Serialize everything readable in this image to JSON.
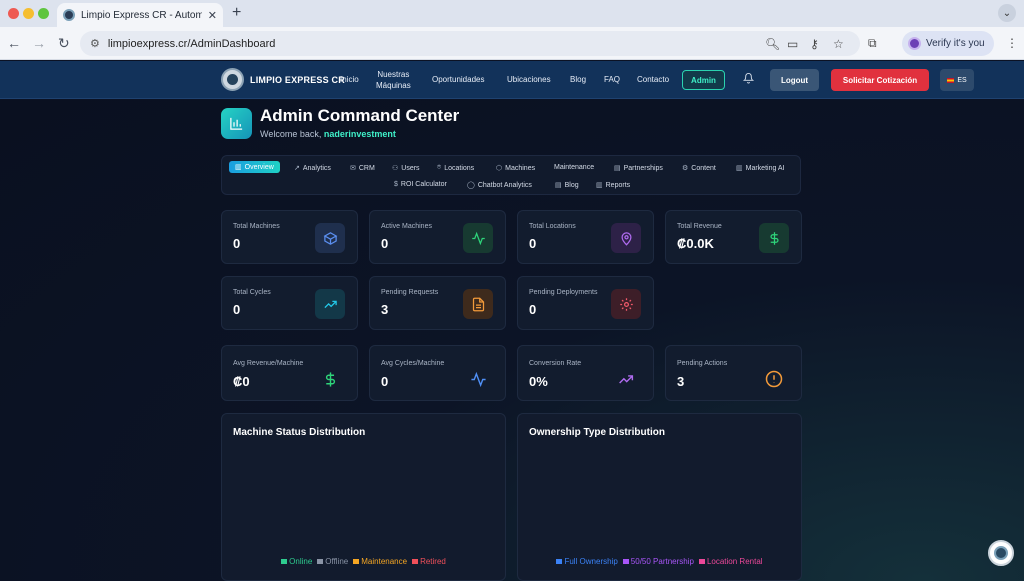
{
  "browser": {
    "tab_title": "Limpio Express CR - Automat",
    "tab_close": "✕",
    "new_tab": "+",
    "menu": "⌄",
    "url": "limpioexpress.cr/AdminDashboard",
    "profile_label": "Verify it's you",
    "back": "←",
    "forward": "→",
    "reload": "↻"
  },
  "header": {
    "brand": "LIMPIO EXPRESS CR",
    "nav": {
      "inicio": "Inicio",
      "maquinas_line1": "Nuestras",
      "maquinas_line2": "Máquinas",
      "oportunidades": "Oportunidades",
      "ubicaciones": "Ubicaciones",
      "blog": "Blog",
      "faq": "FAQ",
      "contacto": "Contacto"
    },
    "admin": "Admin",
    "logout": "Logout",
    "quote": "Solicitar Cotización",
    "lang": "ES"
  },
  "dashboard": {
    "title": "Admin Command Center",
    "welcome_prefix": "Welcome back, ",
    "username": "naderinvestment"
  },
  "tabs": {
    "overview": "Overview",
    "analytics": "Analytics",
    "crm": "CRM",
    "users": "Users",
    "locations": "Locations",
    "machines": "Machines",
    "maintenance": "Maintenance",
    "partnerships": "Partnerships",
    "content": "Content",
    "marketing_ai": "Marketing AI",
    "roi_calculator": "ROI Calculator",
    "chatbot_analytics": "Chatbot Analytics",
    "blog": "Blog",
    "reports": "Reports"
  },
  "stats": {
    "total_machines": {
      "label": "Total Machines",
      "value": "0",
      "color": "#5b8ff0"
    },
    "active_machines": {
      "label": "Active Machines",
      "value": "0",
      "color": "#2ed47a"
    },
    "total_locations": {
      "label": "Total Locations",
      "value": "0",
      "color": "#b06cf0"
    },
    "total_revenue": {
      "label": "Total Revenue",
      "value": "₡0.0K",
      "color": "#2ed47a"
    },
    "total_cycles": {
      "label": "Total Cycles",
      "value": "0",
      "color": "#23c8e8"
    },
    "pending_requests": {
      "label": "Pending Requests",
      "value": "3",
      "color": "#f39a3a"
    },
    "pending_deployments": {
      "label": "Pending Deployments",
      "value": "0",
      "color": "#f05a6a"
    },
    "avg_revenue": {
      "label": "Avg Revenue/Machine",
      "value": "₡0",
      "color": "#2ed47a"
    },
    "avg_cycles": {
      "label": "Avg Cycles/Machine",
      "value": "0",
      "color": "#4f8ff5"
    },
    "conversion_rate": {
      "label": "Conversion Rate",
      "value": "0%",
      "color": "#b06cf0"
    },
    "pending_actions": {
      "label": "Pending Actions",
      "value": "3",
      "color": "#f39a3a"
    }
  },
  "machine_status": {
    "title": "Machine Status Distribution",
    "legend": [
      {
        "label": "Online",
        "color": "#2ecc8f"
      },
      {
        "label": "Offline",
        "color": "#8a94a6"
      },
      {
        "label": "Maintenance",
        "color": "#f5a623"
      },
      {
        "label": "Retired",
        "color": "#f0505a"
      }
    ]
  },
  "ownership": {
    "title": "Ownership Type Distribution",
    "legend": [
      {
        "label": "Full Ownership",
        "color": "#3b82f6"
      },
      {
        "label": "50/50 Partnership",
        "color": "#a855f7"
      },
      {
        "label": "Location Rental",
        "color": "#ec4899"
      }
    ]
  }
}
